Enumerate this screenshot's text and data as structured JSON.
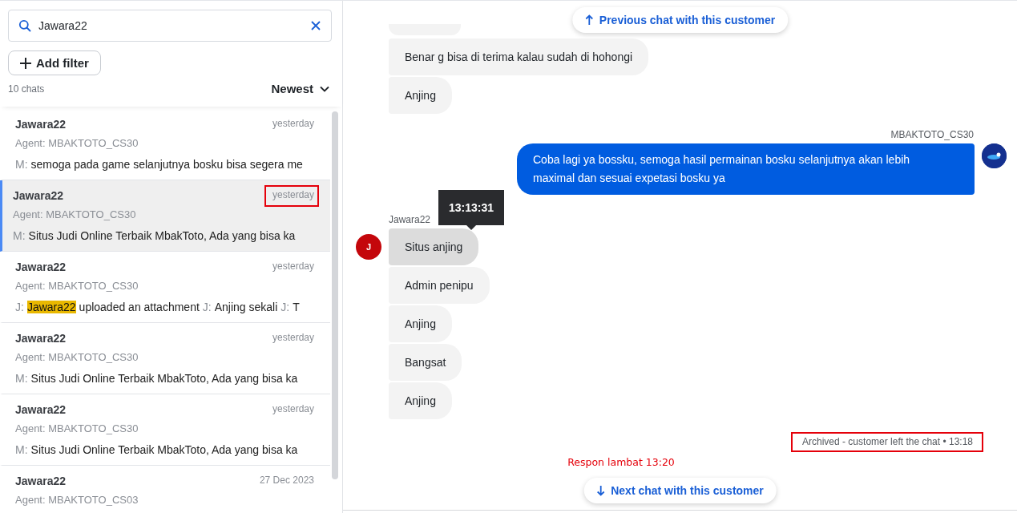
{
  "search": {
    "value": "Jawara22"
  },
  "add_filter": {
    "label": "Add filter"
  },
  "chat_count": "10 chats",
  "sort": {
    "label": "Newest"
  },
  "chats": [
    {
      "name": "Jawara22",
      "date": "yesterday",
      "agent": "Agent: MBAKTOTO_CS30",
      "selected": false,
      "date_highlighted": false,
      "preview": [
        {
          "kind": "prefix",
          "text": "M:"
        },
        {
          "kind": "text",
          "text": "semoga pada game selanjutnya bosku bisa segera me"
        }
      ]
    },
    {
      "name": "Jawara22",
      "date": "yesterday",
      "agent": "Agent: MBAKTOTO_CS30",
      "selected": true,
      "date_highlighted": true,
      "preview": [
        {
          "kind": "prefix",
          "text": "M:"
        },
        {
          "kind": "text",
          "text": "Situs Judi Online Terbaik MbakToto, Ada yang bisa ka"
        }
      ]
    },
    {
      "name": "Jawara22",
      "date": "yesterday",
      "agent": "Agent: MBAKTOTO_CS30",
      "selected": false,
      "date_highlighted": false,
      "preview": [
        {
          "kind": "prefix",
          "text": "J:"
        },
        {
          "kind": "match",
          "text": "Jawara22"
        },
        {
          "kind": "text",
          "text": "uploaded an attachment"
        },
        {
          "kind": "prefix",
          "text": "J:"
        },
        {
          "kind": "text",
          "text": "Anjing sekali"
        },
        {
          "kind": "prefix",
          "text": "J:"
        },
        {
          "kind": "text",
          "text": "T"
        }
      ]
    },
    {
      "name": "Jawara22",
      "date": "yesterday",
      "agent": "Agent: MBAKTOTO_CS30",
      "selected": false,
      "date_highlighted": false,
      "preview": [
        {
          "kind": "prefix",
          "text": "M:"
        },
        {
          "kind": "text",
          "text": "Situs Judi Online Terbaik MbakToto, Ada yang bisa ka"
        }
      ]
    },
    {
      "name": "Jawara22",
      "date": "yesterday",
      "agent": "Agent: MBAKTOTO_CS30",
      "selected": false,
      "date_highlighted": false,
      "preview": [
        {
          "kind": "prefix",
          "text": "M:"
        },
        {
          "kind": "text",
          "text": "Situs Judi Online Terbaik MbakToto, Ada yang bisa ka"
        }
      ]
    },
    {
      "name": "Jawara22",
      "date": "27 Dec 2023",
      "agent": "Agent: MBAKTOTO_CS03",
      "selected": false,
      "date_highlighted": false
    }
  ],
  "thread": {
    "previous_button": "Previous chat with this customer",
    "clipped_above": true,
    "groups": [
      {
        "kind": "customer",
        "messages": [
          {
            "text": "Benar g bisa di terima kalau sudah di hohongi",
            "hovered": false
          },
          {
            "text": "Anjing",
            "hovered": false
          }
        ]
      },
      {
        "kind": "agent",
        "sender": "MBAKTOTO_CS30",
        "messages": [
          {
            "text": "Coba lagi ya bossku, semoga hasil permainan bosku selanjutnya akan lebih maximal dan sesuai expetasi bosku ya"
          }
        ]
      },
      {
        "kind": "customer",
        "sender": "Jawara22",
        "avatar": "J",
        "messages": [
          {
            "text": "Situs anjing",
            "hovered": true,
            "tooltip": "13:13:31"
          },
          {
            "text": "Admin penipu",
            "hovered": false
          },
          {
            "text": "Anjing",
            "hovered": false
          },
          {
            "text": "Bangsat",
            "hovered": false
          },
          {
            "text": "Anjing",
            "hovered": false
          }
        ]
      }
    ],
    "status": {
      "text": "Archived - customer left the chat • 13:18",
      "highlighted": true
    },
    "annotation": "Respon lambat 13:20",
    "next_button": "Next chat with this customer"
  }
}
